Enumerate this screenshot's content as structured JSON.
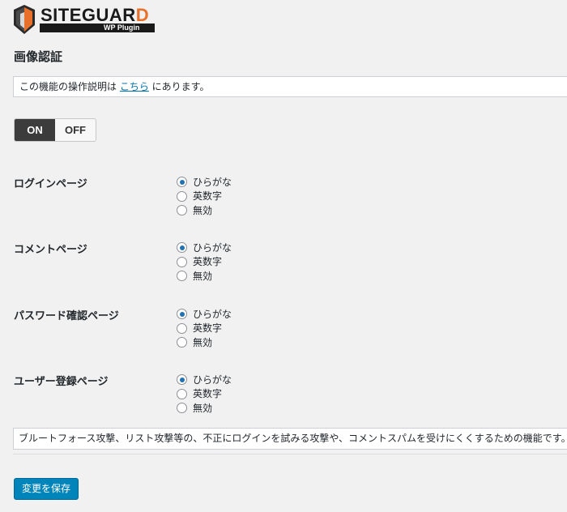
{
  "logo": {
    "word_main": "SITEGUAR",
    "word_last": "D",
    "sub": "WP Plugin"
  },
  "page_title": "画像認証",
  "notice": {
    "before": "この機能の操作説明は ",
    "link": "こちら",
    "after": " にあります。"
  },
  "toggle": {
    "on_label": "ON",
    "off_label": "OFF",
    "selected": "on"
  },
  "options": [
    "ひらがな",
    "英数字",
    "無効"
  ],
  "sections": [
    {
      "label": "ログインページ",
      "selected": 0
    },
    {
      "label": "コメントページ",
      "selected": 0
    },
    {
      "label": "パスワード確認ページ",
      "selected": 0
    },
    {
      "label": "ユーザー登録ページ",
      "selected": 0
    }
  ],
  "description": "ブルートフォース攻撃、リスト攻撃等の、不正にログインを試みる攻撃や、コメントスパムを受けにくくするための機能です。",
  "save_label": "変更を保存",
  "colors": {
    "primary": "#0085ba",
    "link": "#0073aa",
    "logo_accent": "#e8702a",
    "toggle_on": "#3c3c3c"
  }
}
